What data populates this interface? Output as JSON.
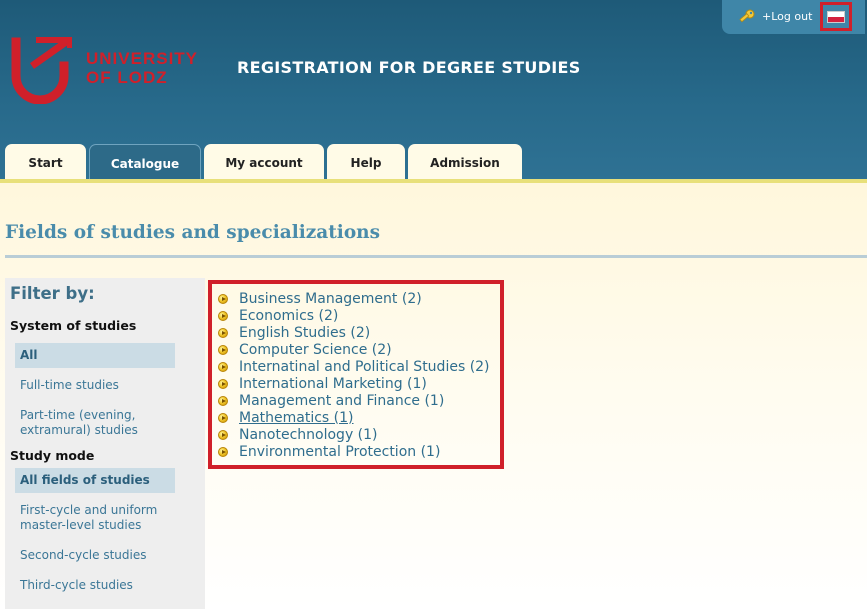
{
  "header": {
    "logo_line1": "UNIVERSITY",
    "logo_line2": "OF LODZ",
    "title": "REGISTRATION FOR DEGREE STUDIES",
    "logout_label": "+Log out",
    "language_flag": "polish-flag-icon"
  },
  "tabs": [
    {
      "label": "Start",
      "active": false
    },
    {
      "label": "Catalogue",
      "active": true
    },
    {
      "label": "My account",
      "active": false
    },
    {
      "label": "Help",
      "active": false
    },
    {
      "label": "Admission",
      "active": false
    }
  ],
  "page": {
    "title": "Fields of studies and specializations"
  },
  "sidebar": {
    "filter_title": "Filter by:",
    "system": {
      "title": "System of studies",
      "options": [
        {
          "label": "All",
          "selected": true
        },
        {
          "label": "Full-time studies",
          "selected": false
        },
        {
          "label": "Part-time (evening, extramural) studies",
          "selected": false
        }
      ]
    },
    "mode": {
      "title": "Study mode",
      "options": [
        {
          "label": "All fields of studies",
          "selected": true
        },
        {
          "label": "First-cycle and uniform master-level studies",
          "selected": false
        },
        {
          "label": "Second-cycle studies",
          "selected": false
        },
        {
          "label": "Third-cycle studies",
          "selected": false
        }
      ]
    }
  },
  "fields": [
    "Business Management (2)",
    "Economics (2)",
    "English Studies (2)",
    "Computer Science (2)",
    "Internatinal and Political Studies (2)",
    "International Marketing (1)",
    "Management and Finance (1)",
    "Mathematics (1)",
    "Nanotechnology (1)",
    "Environmental Protection (1)"
  ],
  "colors": {
    "header_bg": "#27698a",
    "accent_red": "#d0202a",
    "link_blue": "#2f6d8d",
    "title_blue": "#4a8cab"
  }
}
